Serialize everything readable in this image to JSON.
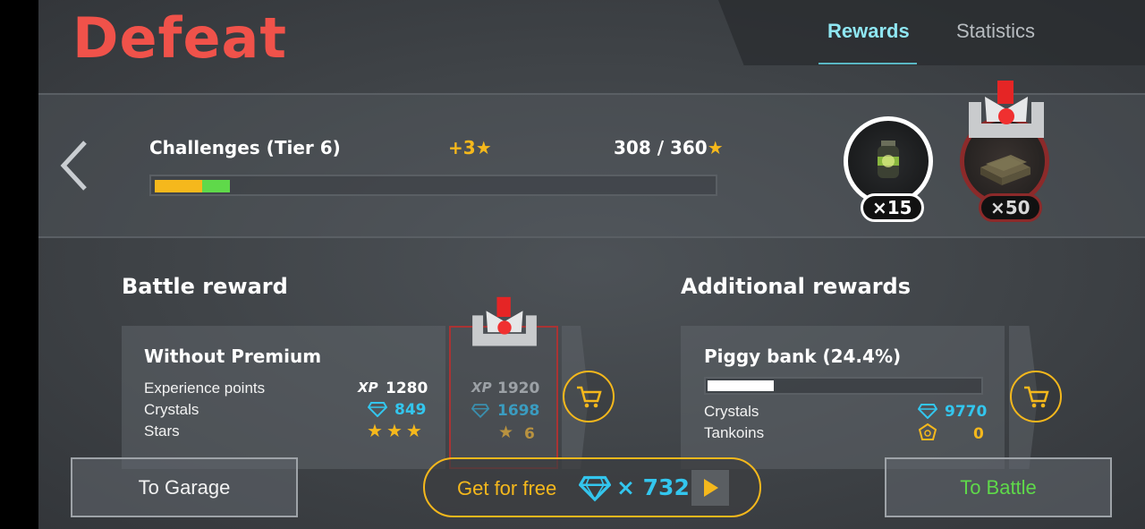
{
  "header": {
    "result_title": "Defeat",
    "tabs": [
      {
        "label": "Rewards",
        "active": true
      },
      {
        "label": "Statistics",
        "active": false
      }
    ]
  },
  "challenges": {
    "title": "Challenges (Tier 6)",
    "gain": "+3",
    "progress_text": "308 / 360",
    "progress_value": 308,
    "progress_max": 360,
    "bar_segments": [
      {
        "color": "#f5b81c",
        "fraction": 0.085
      },
      {
        "color": "#5fd94a",
        "fraction": 0.05
      }
    ],
    "rewards": [
      {
        "icon": "grenade-consumable-icon",
        "count": "×15"
      },
      {
        "icon": "ammo-crate-icon",
        "count": "×50",
        "premium_locked": true
      }
    ]
  },
  "battle_reward": {
    "section_title": "Battle reward",
    "panel_title": "Without Premium",
    "rows": [
      {
        "label": "Experience points",
        "icon": "xp-icon",
        "icon_text": "XP",
        "value": "1280",
        "premium_value": "1920"
      },
      {
        "label": "Crystals",
        "icon": "crystal-icon",
        "value": "849",
        "premium_value": "1698"
      },
      {
        "label": "Stars",
        "icon": "star-icon",
        "value_stars": 3,
        "premium_value": "6"
      }
    ]
  },
  "additional_rewards": {
    "section_title": "Additional rewards",
    "panel_title": "Piggy bank (24.4%)",
    "piggy_fraction": 0.244,
    "rows": [
      {
        "label": "Crystals",
        "icon": "crystal-icon",
        "value": "9770"
      },
      {
        "label": "Tankoins",
        "icon": "tankoin-icon",
        "value": "0"
      }
    ]
  },
  "footer": {
    "garage_label": "To Garage",
    "free_label": "Get for free",
    "free_count": "× 732",
    "battle_label": "To Battle"
  },
  "colors": {
    "defeat": "#f0524a",
    "accent_gold": "#f5b81c",
    "crystal_blue": "#33c6ee",
    "battle_green": "#5fd94a",
    "active_tab": "#8fe6f2"
  }
}
